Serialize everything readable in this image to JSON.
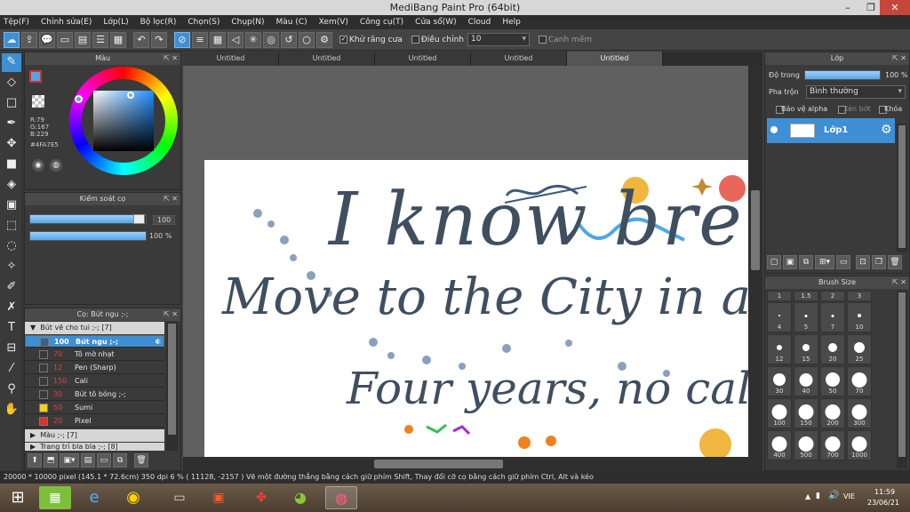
{
  "window": {
    "title": "MediBang Paint Pro (64bit)"
  },
  "menu": [
    "Tệp(F)",
    "Chỉnh sửa(E)",
    "Lớp(L)",
    "Bộ lọc(R)",
    "Chọn(S)",
    "Chụp(N)",
    "Màu (C)",
    "Xem(V)",
    "Công cụ(T)",
    "Cửa sổ(W)",
    "Cloud",
    "Help"
  ],
  "toolbar": {
    "antialias_label": "Khử răng cưa",
    "adjust_label": "Điều chỉnh",
    "adjust_value": "10",
    "smooth_label": "Canh mềm"
  },
  "tabs": [
    "Untitled",
    "Untitled",
    "Untitled",
    "Untitled",
    "Untitled"
  ],
  "color_panel": {
    "title": "Màu",
    "r": "R:79",
    "g": "G:167",
    "b": "B:229",
    "hex": "#4FA7E5",
    "current_color": "#4fa7e5"
  },
  "brush_control": {
    "title": "Kiểm soát cọ",
    "size_value": "100",
    "opacity_value": "100 %",
    "size_fraction": 1.0,
    "opacity_fraction": 1.0
  },
  "brush_list": {
    "title": "Cọ: Bút ngu ;-;",
    "group1": "Bút vẽ cho tui ;-; [7]",
    "items": [
      {
        "size": "100",
        "name": "Bút ngu ;-;",
        "color": "#3a5f8a"
      },
      {
        "size": "70",
        "name": "Tô mờ nhạt",
        "color": "#3a3a3a"
      },
      {
        "size": "12",
        "name": "Pen (Sharp)",
        "color": "#3a3a3a"
      },
      {
        "size": "150",
        "name": "Cali",
        "color": "#3a3a3a"
      },
      {
        "size": "30",
        "name": "Bút tô bóng ;-;",
        "color": "#3a3a3a"
      },
      {
        "size": "50",
        "name": "Sumi",
        "color": "#f0d020"
      },
      {
        "size": "20",
        "name": "Pixel",
        "color": "#e03030"
      }
    ],
    "group2": "Màu ;-; [7]",
    "group3": "Trang trí bla bla ;-; [8]"
  },
  "layer_panel": {
    "title": "Lớp",
    "opacity_label": "Độ trong",
    "opacity_value": "100 %",
    "opacity_fraction": 1.0,
    "blend_label": "Pha trộn",
    "blend_value": "Bình thường",
    "protect_alpha": "Bảo vệ alpha",
    "clip": "Xén bớt",
    "lock": "Khóa",
    "layer_name": "Lớp1"
  },
  "brush_size": {
    "title": "Brush Size",
    "header": [
      "1",
      "1.5",
      "2",
      "3"
    ],
    "rows": [
      [
        "4",
        "5",
        "7",
        "10"
      ],
      [
        "12",
        "15",
        "20",
        "25"
      ],
      [
        "30",
        "40",
        "50",
        "70"
      ],
      [
        "100",
        "150",
        "200",
        "300"
      ],
      [
        "400",
        "500",
        "700",
        "1000"
      ]
    ]
  },
  "canvas": {
    "lines": [
      "I know bre",
      "Move to the City in a b",
      "Four years, no cal"
    ]
  },
  "status": {
    "text": "20000 * 10000 pixel   (145.1 * 72.6cm)   350 dpi   6 %   ( 11128, -2157 )   Vẽ một đường thẳng bằng cách giữ phím Shift, Thay đổi cỡ cọ bằng cách giữ phím Ctrl, Alt và kéo"
  },
  "taskbar": {
    "lang": "VIE",
    "time": "11:59",
    "date": "23/06/21"
  }
}
